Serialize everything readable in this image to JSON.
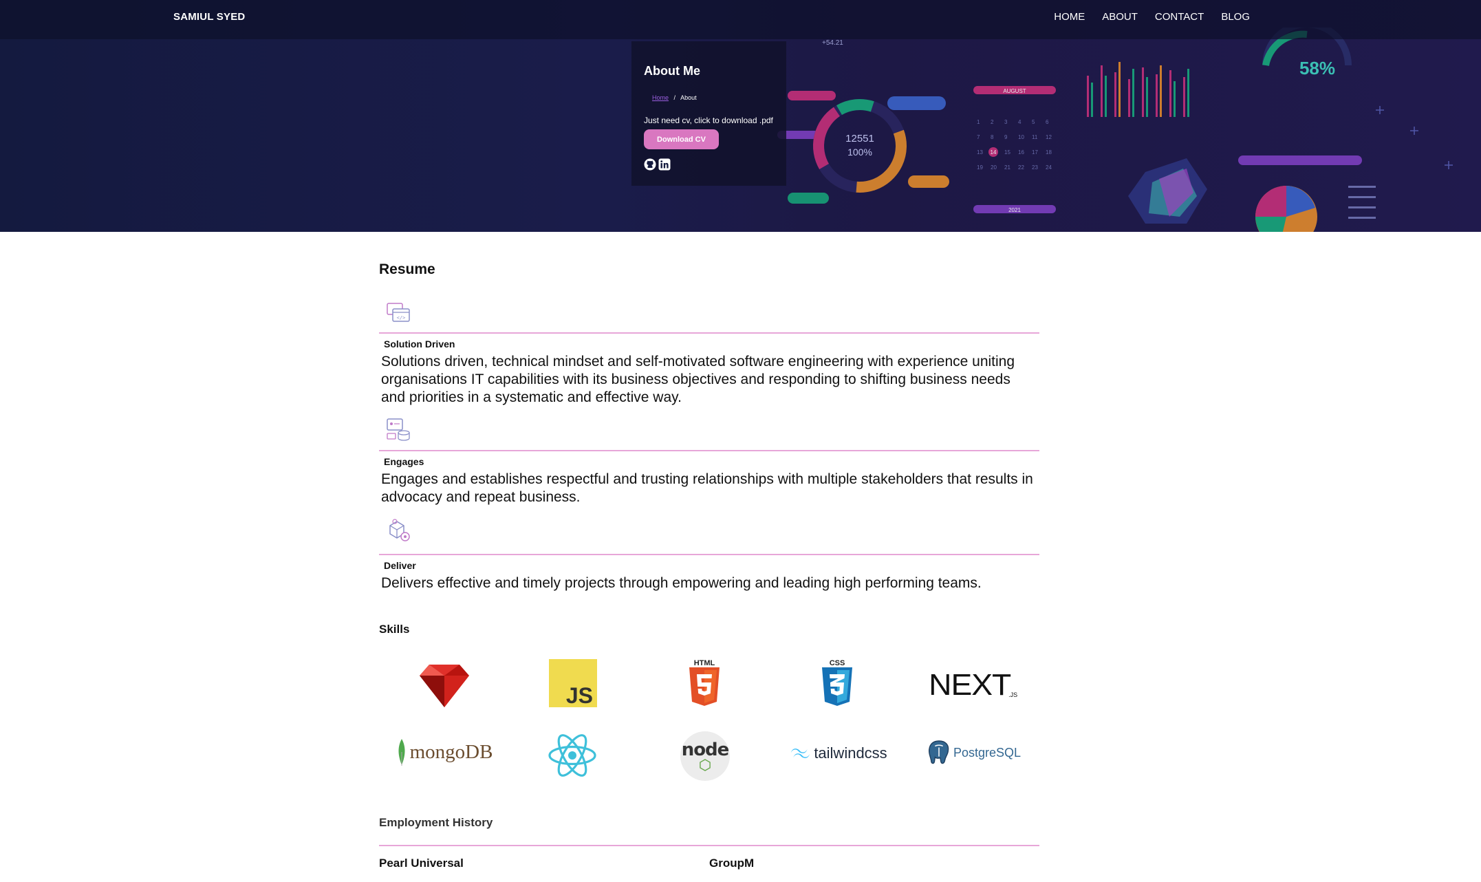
{
  "nav": {
    "brand": "SAMIUL SYED",
    "links": [
      "HOME",
      "ABOUT",
      "CONTACT",
      "BLOG"
    ]
  },
  "hero": {
    "title": "About Me",
    "breadcrumb": {
      "home": "Home",
      "separator": "/",
      "current": "About"
    },
    "cv_text": "Just need cv, click to download .pdf",
    "cv_button": "Download CV",
    "socials": [
      "github-icon",
      "linkedin-icon"
    ],
    "dashboard": {
      "stat_a": "+54.21",
      "ring_value": "12551",
      "ring_percent": "100%",
      "month": "AUGUST",
      "year": "2021",
      "percent": "58%",
      "calendar_highlight": "14"
    }
  },
  "resume": {
    "title": "Resume",
    "items": [
      {
        "icon": "code-window-icon",
        "heading": "Solution Driven",
        "text": "Solutions driven, technical mindset and self-motivated software engineering with experience uniting organisations IT capabilities with its business objectives and responding to shifting business needs and priorities in a systematic and effective way."
      },
      {
        "icon": "stakeholders-icon",
        "heading": "Engages",
        "text": "Engages and establishes respectful and trusting relationships with multiple stakeholders that results in advocacy and repeat business."
      },
      {
        "icon": "delivery-gear-icon",
        "heading": "Deliver",
        "text": "Delivers effective and timely projects through empowering and leading high performing teams."
      }
    ]
  },
  "skills": {
    "title": "Skills",
    "items": [
      {
        "name": "ruby-logo",
        "label": ""
      },
      {
        "name": "javascript-logo",
        "label": "JS"
      },
      {
        "name": "html5-logo",
        "label": "HTML"
      },
      {
        "name": "css3-logo",
        "label": "CSS"
      },
      {
        "name": "nextjs-logo",
        "label": "NEXT",
        "sub": ".JS"
      },
      {
        "name": "mongodb-logo",
        "label": "mongoDB"
      },
      {
        "name": "react-logo",
        "label": ""
      },
      {
        "name": "nodejs-logo",
        "label": "node"
      },
      {
        "name": "tailwindcss-logo",
        "label": "tailwindcss"
      },
      {
        "name": "postgresql-logo",
        "label": "PostgreSQL"
      }
    ]
  },
  "employment": {
    "title": "Employment History",
    "companies": [
      "Pearl Universal",
      "GroupM"
    ]
  },
  "colors": {
    "accent": "#d977c0",
    "divider": "#e7a6d8",
    "hero_bg": "#1a1c4a"
  }
}
